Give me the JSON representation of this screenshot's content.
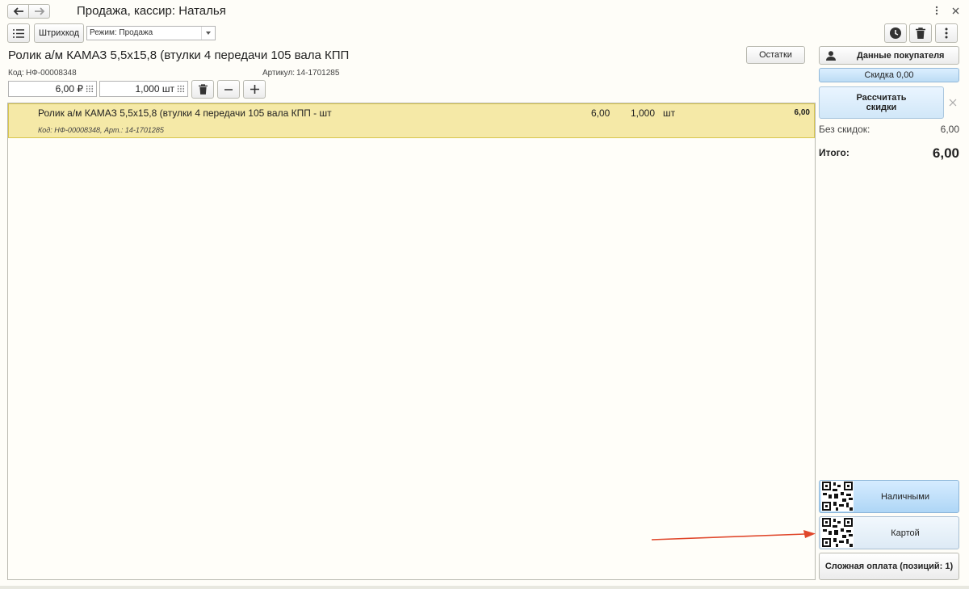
{
  "window": {
    "title": "Продажа, кассир: Наталья"
  },
  "toolbar": {
    "barcode_label": "Штрихкод",
    "mode_value": "Режим: Продажа"
  },
  "product": {
    "title": "Ролик а/м КАМАЗ 5,5х15,8 (втулки 4 передачи 105 вала КПП",
    "code_label": "Код:",
    "code_value": "НФ-00008348",
    "article_label": "Артикул:",
    "article_value": "14-1701285",
    "price_value": "6,00 ₽",
    "qty_value": "1,000 шт",
    "stock_button": "Остатки"
  },
  "items": [
    {
      "name": "Ролик а/м КАМАЗ 5,5х15,8 (втулки 4 передачи 105 вала КПП  - шт",
      "price": "6,00",
      "qty": "1,000",
      "unit": "шт",
      "sum": "6,00",
      "sub": "Код: НФ-00008348, Арт.: 14-1701285"
    }
  ],
  "sidebar": {
    "customer_button": "Данные покупателя",
    "discount_button": "Скидка 0,00",
    "calc_discounts_line1": "Рассчитать",
    "calc_discounts_line2": "скидки",
    "no_discount_label": "Без скидок:",
    "no_discount_value": "6,00",
    "total_label": "Итого:",
    "total_value": "6,00",
    "cash_button": "Наличными",
    "card_button": "Картой",
    "complex_button": "Сложная оплата (позиций: 1)"
  },
  "colors": {
    "row_highlight": "#f5e9a7",
    "blue_button": "#cfe6f8",
    "arrow": "#e0472b"
  }
}
